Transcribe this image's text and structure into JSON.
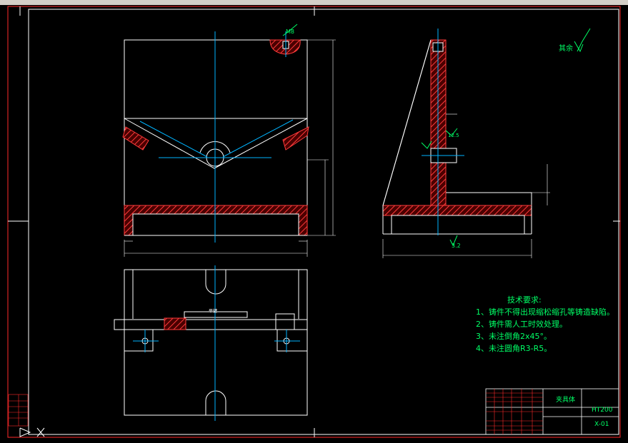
{
  "drawing": {
    "surface_note": "其余",
    "surface_symbol_value": "",
    "tech_title": "技术要求:",
    "tech_lines": [
      "1、铸件不得出现缩松缩孔等铸造缺陷。",
      "2、铸件需人工时效处理。",
      "3、未注倒角2x45°。",
      "4、未注圆角R3-R5。"
    ],
    "title_block": {
      "name": "夹具体",
      "material": "HT200",
      "drawing_no": "X-01"
    },
    "dim_marks": {
      "thread_top": "M8",
      "side_roughness": "3.2",
      "side_roughness_2": "12.5",
      "side_bottom_roughness": "3.2",
      "keyway_label": "平键"
    }
  },
  "colors": {
    "background": "#000000",
    "outline": "#ffffff",
    "border": "#ff0000",
    "centerline": "#00b4ff",
    "hatch": "#ff3b3b",
    "dimension": "#00ff66",
    "note": "#00ff66",
    "toolbar": "#d4d0c8"
  }
}
